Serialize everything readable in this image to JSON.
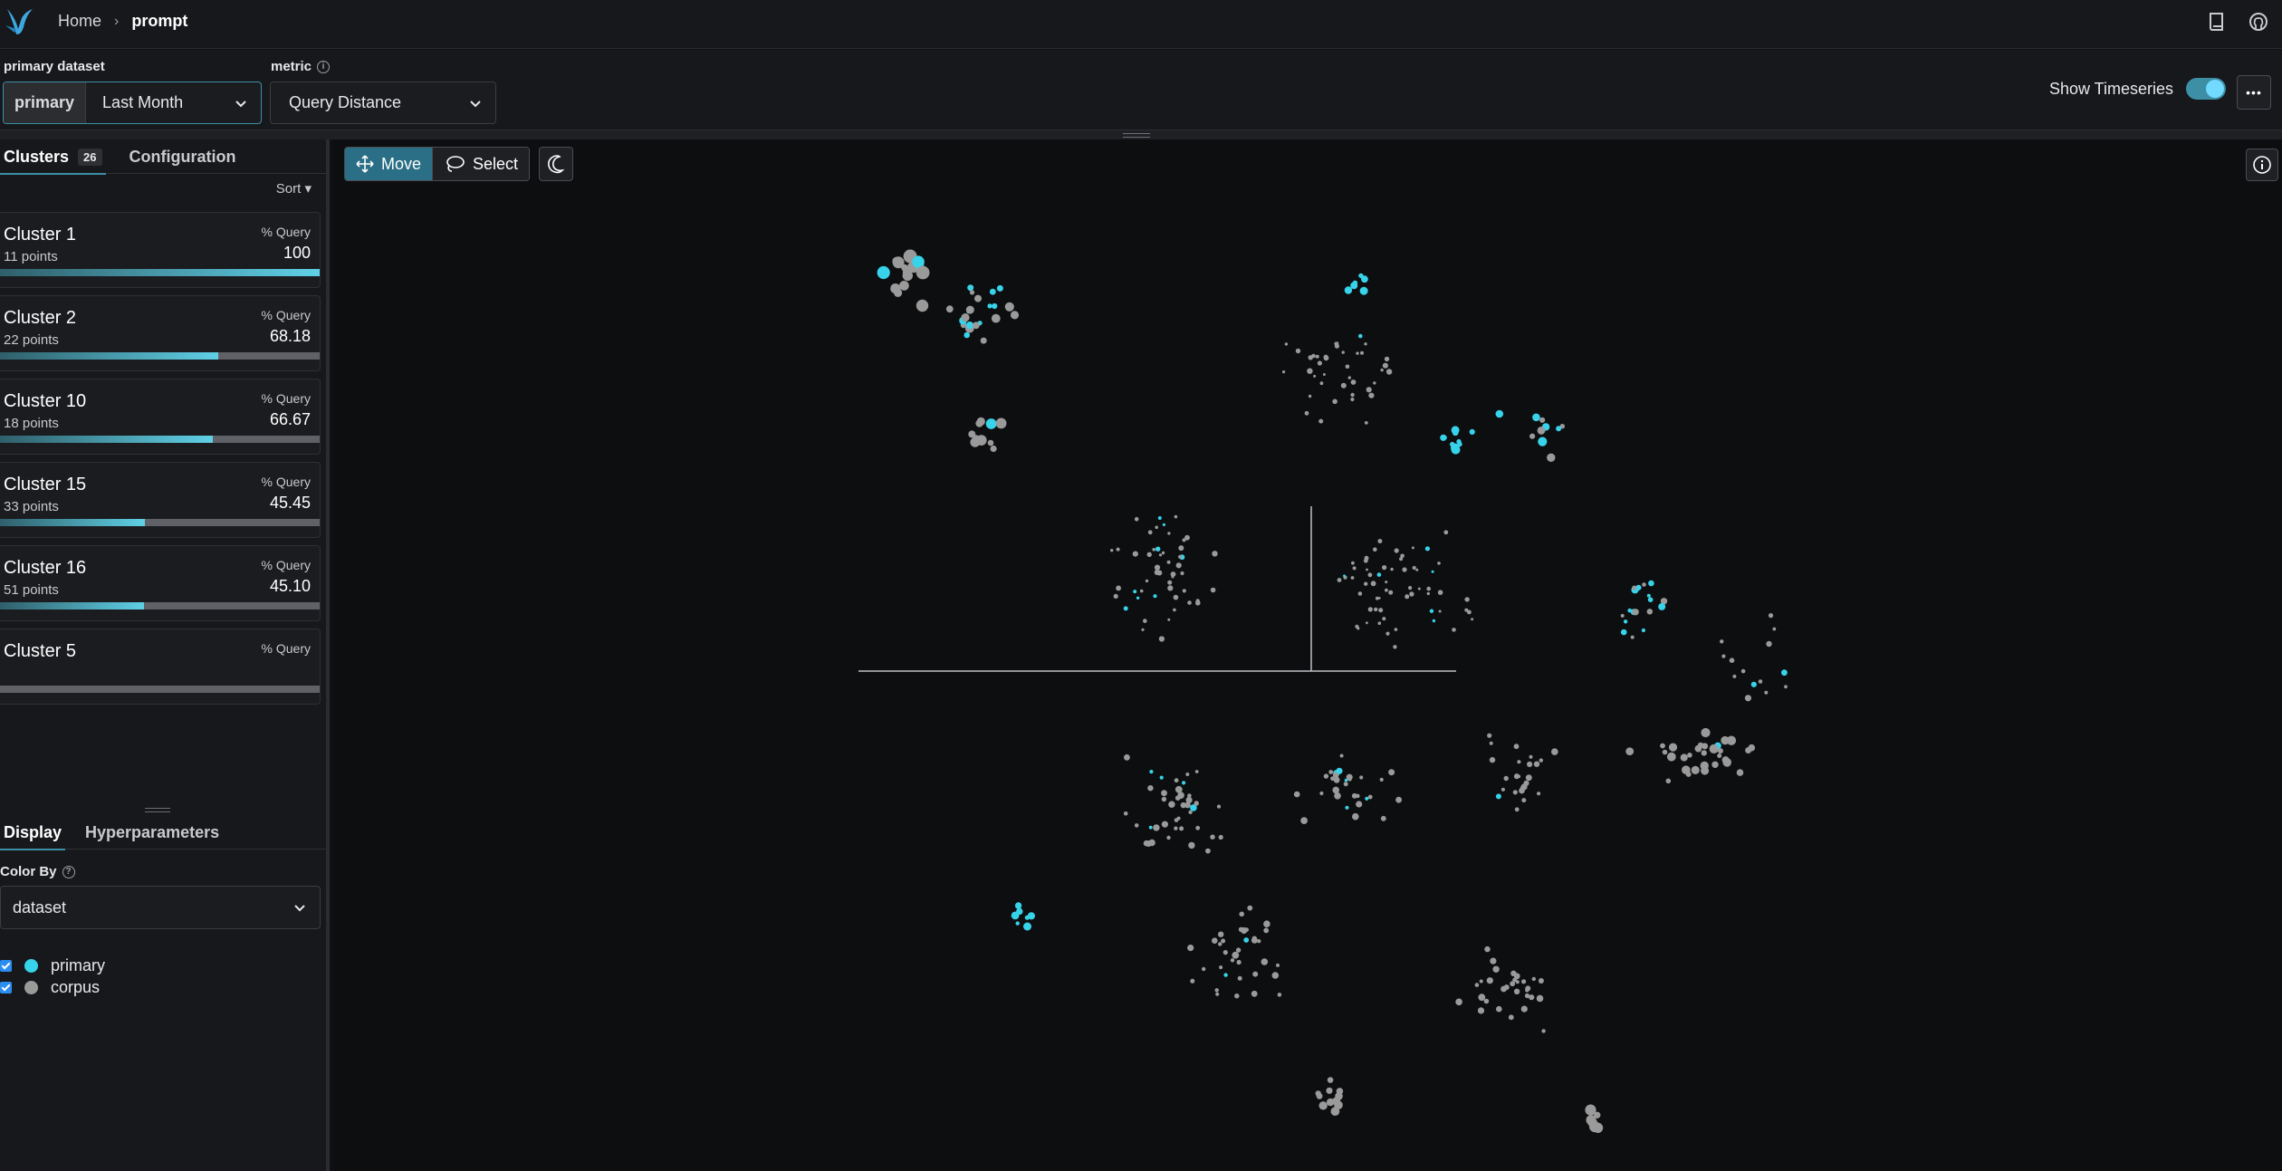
{
  "nav": {
    "home_label": "Home",
    "separator": "›",
    "current_page": "prompt"
  },
  "controls": {
    "primary_dataset_label": "primary dataset",
    "primary_tag": "primary",
    "primary_value": "Last Month",
    "metric_label": "metric",
    "metric_value": "Query Distance",
    "show_timeseries_label": "Show Timeseries",
    "show_timeseries_on": true,
    "more_label": "•••"
  },
  "left_panel": {
    "tabs": [
      {
        "label": "Clusters",
        "count": "26",
        "active": true
      },
      {
        "label": "Configuration",
        "active": false
      }
    ],
    "sort_label": "Sort ▾",
    "clusters": [
      {
        "name": "Cluster 1",
        "points": "11 points",
        "metric_label": "% Query",
        "value": "100",
        "fraction": 1.0
      },
      {
        "name": "Cluster 2",
        "points": "22 points",
        "metric_label": "% Query",
        "value": "68.18",
        "fraction": 0.6818
      },
      {
        "name": "Cluster 10",
        "points": "18 points",
        "metric_label": "% Query",
        "value": "66.67",
        "fraction": 0.6667
      },
      {
        "name": "Cluster 15",
        "points": "33 points",
        "metric_label": "% Query",
        "value": "45.45",
        "fraction": 0.4545
      },
      {
        "name": "Cluster 16",
        "points": "51 points",
        "metric_label": "% Query",
        "value": "45.10",
        "fraction": 0.451
      },
      {
        "name": "Cluster 5",
        "points": "",
        "metric_label": "% Query",
        "value": "",
        "fraction": 0.0
      }
    ],
    "bottom_tabs": [
      {
        "label": "Display",
        "active": true
      },
      {
        "label": "Hyperparameters",
        "active": false
      }
    ],
    "color_by_label": "Color By",
    "color_by_value": "dataset",
    "legend": [
      {
        "label": "primary",
        "color": "#37d3ea",
        "checked": true
      },
      {
        "label": "corpus",
        "color": "#9a9a9a",
        "checked": true
      }
    ]
  },
  "canvas": {
    "move_label": "Move",
    "select_label": "Select",
    "primary_color": "#37d3ea",
    "corpus_color": "#9a9a9a"
  }
}
